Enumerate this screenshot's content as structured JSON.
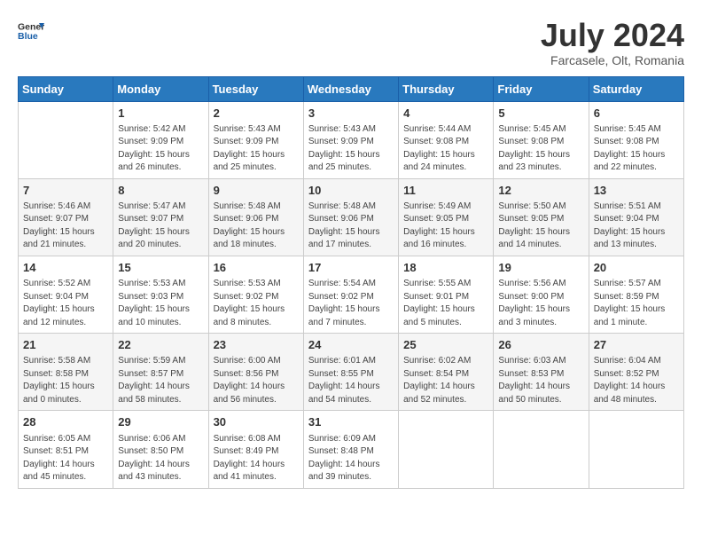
{
  "header": {
    "logo_general": "General",
    "logo_blue": "Blue",
    "month_year": "July 2024",
    "location": "Farcasele, Olt, Romania"
  },
  "days_of_week": [
    "Sunday",
    "Monday",
    "Tuesday",
    "Wednesday",
    "Thursday",
    "Friday",
    "Saturday"
  ],
  "weeks": [
    {
      "cells": [
        {
          "day": "",
          "info": ""
        },
        {
          "day": "1",
          "info": "Sunrise: 5:42 AM\nSunset: 9:09 PM\nDaylight: 15 hours\nand 26 minutes."
        },
        {
          "day": "2",
          "info": "Sunrise: 5:43 AM\nSunset: 9:09 PM\nDaylight: 15 hours\nand 25 minutes."
        },
        {
          "day": "3",
          "info": "Sunrise: 5:43 AM\nSunset: 9:09 PM\nDaylight: 15 hours\nand 25 minutes."
        },
        {
          "day": "4",
          "info": "Sunrise: 5:44 AM\nSunset: 9:08 PM\nDaylight: 15 hours\nand 24 minutes."
        },
        {
          "day": "5",
          "info": "Sunrise: 5:45 AM\nSunset: 9:08 PM\nDaylight: 15 hours\nand 23 minutes."
        },
        {
          "day": "6",
          "info": "Sunrise: 5:45 AM\nSunset: 9:08 PM\nDaylight: 15 hours\nand 22 minutes."
        }
      ]
    },
    {
      "cells": [
        {
          "day": "7",
          "info": "Sunrise: 5:46 AM\nSunset: 9:07 PM\nDaylight: 15 hours\nand 21 minutes."
        },
        {
          "day": "8",
          "info": "Sunrise: 5:47 AM\nSunset: 9:07 PM\nDaylight: 15 hours\nand 20 minutes."
        },
        {
          "day": "9",
          "info": "Sunrise: 5:48 AM\nSunset: 9:06 PM\nDaylight: 15 hours\nand 18 minutes."
        },
        {
          "day": "10",
          "info": "Sunrise: 5:48 AM\nSunset: 9:06 PM\nDaylight: 15 hours\nand 17 minutes."
        },
        {
          "day": "11",
          "info": "Sunrise: 5:49 AM\nSunset: 9:05 PM\nDaylight: 15 hours\nand 16 minutes."
        },
        {
          "day": "12",
          "info": "Sunrise: 5:50 AM\nSunset: 9:05 PM\nDaylight: 15 hours\nand 14 minutes."
        },
        {
          "day": "13",
          "info": "Sunrise: 5:51 AM\nSunset: 9:04 PM\nDaylight: 15 hours\nand 13 minutes."
        }
      ]
    },
    {
      "cells": [
        {
          "day": "14",
          "info": "Sunrise: 5:52 AM\nSunset: 9:04 PM\nDaylight: 15 hours\nand 12 minutes."
        },
        {
          "day": "15",
          "info": "Sunrise: 5:53 AM\nSunset: 9:03 PM\nDaylight: 15 hours\nand 10 minutes."
        },
        {
          "day": "16",
          "info": "Sunrise: 5:53 AM\nSunset: 9:02 PM\nDaylight: 15 hours\nand 8 minutes."
        },
        {
          "day": "17",
          "info": "Sunrise: 5:54 AM\nSunset: 9:02 PM\nDaylight: 15 hours\nand 7 minutes."
        },
        {
          "day": "18",
          "info": "Sunrise: 5:55 AM\nSunset: 9:01 PM\nDaylight: 15 hours\nand 5 minutes."
        },
        {
          "day": "19",
          "info": "Sunrise: 5:56 AM\nSunset: 9:00 PM\nDaylight: 15 hours\nand 3 minutes."
        },
        {
          "day": "20",
          "info": "Sunrise: 5:57 AM\nSunset: 8:59 PM\nDaylight: 15 hours\nand 1 minute."
        }
      ]
    },
    {
      "cells": [
        {
          "day": "21",
          "info": "Sunrise: 5:58 AM\nSunset: 8:58 PM\nDaylight: 15 hours\nand 0 minutes."
        },
        {
          "day": "22",
          "info": "Sunrise: 5:59 AM\nSunset: 8:57 PM\nDaylight: 14 hours\nand 58 minutes."
        },
        {
          "day": "23",
          "info": "Sunrise: 6:00 AM\nSunset: 8:56 PM\nDaylight: 14 hours\nand 56 minutes."
        },
        {
          "day": "24",
          "info": "Sunrise: 6:01 AM\nSunset: 8:55 PM\nDaylight: 14 hours\nand 54 minutes."
        },
        {
          "day": "25",
          "info": "Sunrise: 6:02 AM\nSunset: 8:54 PM\nDaylight: 14 hours\nand 52 minutes."
        },
        {
          "day": "26",
          "info": "Sunrise: 6:03 AM\nSunset: 8:53 PM\nDaylight: 14 hours\nand 50 minutes."
        },
        {
          "day": "27",
          "info": "Sunrise: 6:04 AM\nSunset: 8:52 PM\nDaylight: 14 hours\nand 48 minutes."
        }
      ]
    },
    {
      "cells": [
        {
          "day": "28",
          "info": "Sunrise: 6:05 AM\nSunset: 8:51 PM\nDaylight: 14 hours\nand 45 minutes."
        },
        {
          "day": "29",
          "info": "Sunrise: 6:06 AM\nSunset: 8:50 PM\nDaylight: 14 hours\nand 43 minutes."
        },
        {
          "day": "30",
          "info": "Sunrise: 6:08 AM\nSunset: 8:49 PM\nDaylight: 14 hours\nand 41 minutes."
        },
        {
          "day": "31",
          "info": "Sunrise: 6:09 AM\nSunset: 8:48 PM\nDaylight: 14 hours\nand 39 minutes."
        },
        {
          "day": "",
          "info": ""
        },
        {
          "day": "",
          "info": ""
        },
        {
          "day": "",
          "info": ""
        }
      ]
    }
  ]
}
